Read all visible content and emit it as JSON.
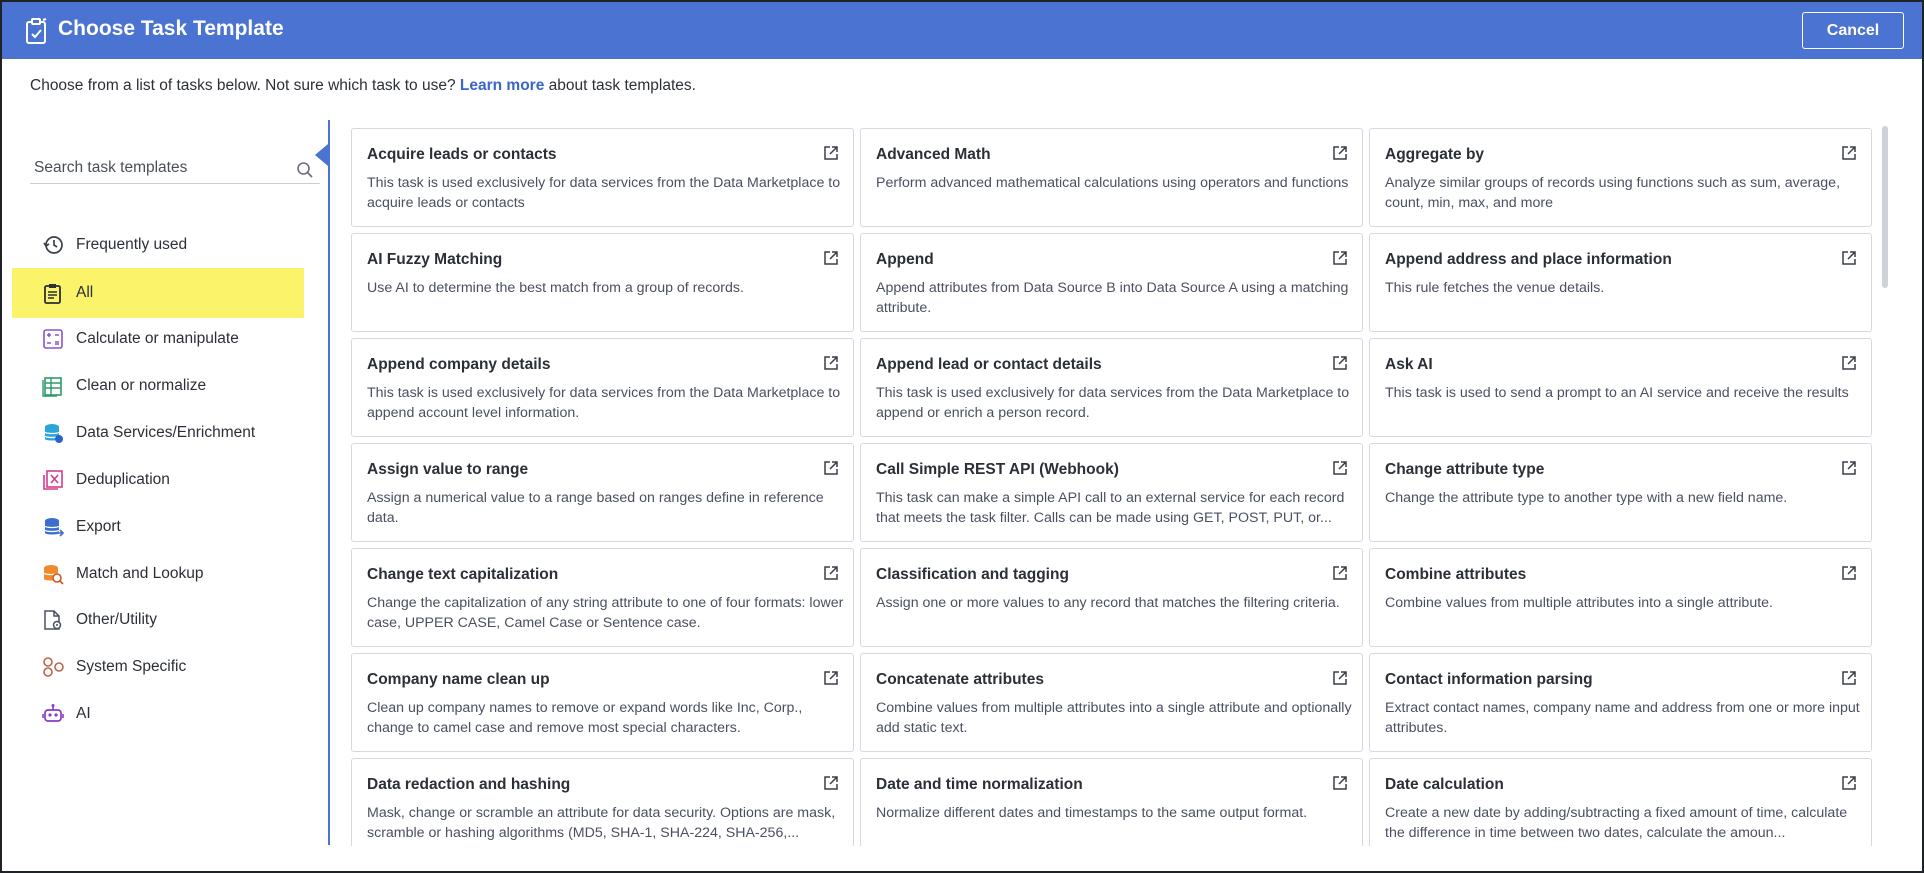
{
  "header": {
    "title": "Choose Task Template",
    "cancel_label": "Cancel"
  },
  "intro": {
    "text_before": "Choose from a list of tasks below. Not sure which task to use? ",
    "link": "Learn more",
    "text_after": " about task templates."
  },
  "search": {
    "placeholder": "Search task templates"
  },
  "sidebar": {
    "items": [
      {
        "label": "Frequently used",
        "icon": "history-icon"
      },
      {
        "label": "All",
        "icon": "clipboard-icon",
        "active": true
      },
      {
        "label": "Calculate or manipulate",
        "icon": "calculator-icon"
      },
      {
        "label": "Clean or normalize",
        "icon": "table-clean-icon"
      },
      {
        "label": "Data Services/Enrichment",
        "icon": "database-icon"
      },
      {
        "label": "Deduplication",
        "icon": "dedupe-icon"
      },
      {
        "label": "Export",
        "icon": "export-icon"
      },
      {
        "label": "Match and Lookup",
        "icon": "match-lookup-icon"
      },
      {
        "label": "Other/Utility",
        "icon": "file-gear-icon"
      },
      {
        "label": "System Specific",
        "icon": "nodes-icon"
      },
      {
        "label": "AI",
        "icon": "robot-icon"
      }
    ]
  },
  "cards": [
    {
      "title": "Acquire leads or contacts",
      "desc": "This task is used exclusively for data services from the Data Marketplace to acquire leads or contacts"
    },
    {
      "title": "Advanced Math",
      "desc": "Perform advanced mathematical calculations using operators and functions"
    },
    {
      "title": "Aggregate by",
      "desc": "Analyze similar groups of records using functions such as sum, average, count, min, max, and more"
    },
    {
      "title": "AI Fuzzy Matching",
      "desc": "Use AI to determine the best match from a group of records."
    },
    {
      "title": "Append",
      "desc": "Append attributes from Data Source B into Data Source A using a matching attribute."
    },
    {
      "title": "Append address and place information",
      "desc": "This rule fetches the venue details."
    },
    {
      "title": "Append company details",
      "desc": "This task is used exclusively for data services from the Data Marketplace to append account level information."
    },
    {
      "title": "Append lead or contact details",
      "desc": "This task is used exclusively for data services from the Data Marketplace to append or enrich a person record."
    },
    {
      "title": "Ask AI",
      "desc": "This task is used to send a prompt to an AI service and receive the results"
    },
    {
      "title": "Assign value to range",
      "desc": "Assign a numerical value to a range based on ranges define in reference data."
    },
    {
      "title": "Call Simple REST API (Webhook)",
      "desc": "This task can make a simple API call to an external service for each record that meets the task filter. Calls can be made using GET, POST, PUT, or..."
    },
    {
      "title": "Change attribute type",
      "desc": "Change the attribute type to another type with a new field name."
    },
    {
      "title": "Change text capitalization",
      "desc": "Change the capitalization of any string attribute to one of four formats: lower case, UPPER CASE, Camel Case or Sentence case."
    },
    {
      "title": "Classification and tagging",
      "desc": "Assign one or more values to any record that matches the filtering criteria."
    },
    {
      "title": "Combine attributes",
      "desc": "Combine values from multiple attributes into a single attribute."
    },
    {
      "title": "Company name clean up",
      "desc": "Clean up company names to remove or expand words like Inc, Corp., change to camel case and remove most special characters."
    },
    {
      "title": "Concatenate attributes",
      "desc": "Combine values from multiple attributes into a single attribute and optionally add static text."
    },
    {
      "title": "Contact information parsing",
      "desc": "Extract contact names, company name and address from one or more input attributes."
    },
    {
      "title": "Data redaction and hashing",
      "desc": "Mask, change or scramble an attribute for data security. Options are mask, scramble or hashing algorithms (MD5, SHA-1, SHA-224, SHA-256,..."
    },
    {
      "title": "Date and time normalization",
      "desc": "Normalize different dates and timestamps to the same output format."
    },
    {
      "title": "Date calculation",
      "desc": "Create a new date by adding/subtracting a fixed amount of time, calculate the difference in time between two dates, calculate the amoun..."
    }
  ],
  "colors": {
    "header_bg": "#4a73d2",
    "active_item_bg": "#fbf36a",
    "link": "#3a66c8"
  }
}
